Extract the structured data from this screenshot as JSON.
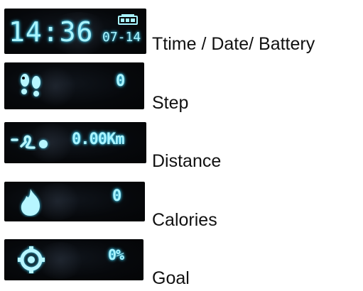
{
  "rows": [
    {
      "display": {
        "time": "14:36",
        "date": "07-14"
      },
      "caption": "Ttime / Date/ Battery",
      "icon": "battery-icon"
    },
    {
      "display": {
        "value": "0"
      },
      "caption": "Step",
      "icon": "footprints-icon"
    },
    {
      "display": {
        "value": "0.00Km"
      },
      "caption": "Distance",
      "icon": "distance-path-icon"
    },
    {
      "display": {
        "value": "0"
      },
      "caption": "Calories",
      "icon": "flame-icon"
    },
    {
      "display": {
        "value": "0%"
      },
      "caption": "Goal",
      "icon": "target-icon"
    }
  ],
  "colors": {
    "lcd_text": "#a9f4ff",
    "lcd_glow": "#3fd8ff",
    "screen_bg": "#06080b"
  }
}
